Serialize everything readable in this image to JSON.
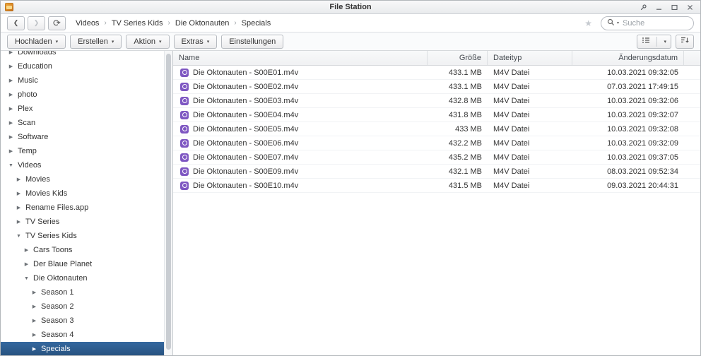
{
  "window": {
    "title": "File Station"
  },
  "icons": {
    "back": "❮",
    "forward": "❯",
    "refresh": "⟳",
    "star": "★",
    "caret": "▾",
    "search_caret": "▾",
    "expand": "▶",
    "collapse": "▼",
    "breadcrumb_sep": "›"
  },
  "nav": {
    "breadcrumb": [
      "Videos",
      "TV Series Kids",
      "Die Oktonauten",
      "Specials"
    ],
    "search_placeholder": "Suche"
  },
  "toolbar": {
    "buttons": [
      {
        "label": "Hochladen",
        "dropdown": true
      },
      {
        "label": "Erstellen",
        "dropdown": true
      },
      {
        "label": "Aktion",
        "dropdown": true
      },
      {
        "label": "Extras",
        "dropdown": true
      },
      {
        "label": "Einstellungen",
        "dropdown": false
      }
    ]
  },
  "sidebar": {
    "items": [
      {
        "label": "Downloads",
        "level": 0,
        "expanded": false,
        "selected": false
      },
      {
        "label": "Education",
        "level": 0,
        "expanded": false,
        "selected": false
      },
      {
        "label": "Music",
        "level": 0,
        "expanded": false,
        "selected": false
      },
      {
        "label": "photo",
        "level": 0,
        "expanded": false,
        "selected": false
      },
      {
        "label": "Plex",
        "level": 0,
        "expanded": false,
        "selected": false
      },
      {
        "label": "Scan",
        "level": 0,
        "expanded": false,
        "selected": false
      },
      {
        "label": "Software",
        "level": 0,
        "expanded": false,
        "selected": false
      },
      {
        "label": "Temp",
        "level": 0,
        "expanded": false,
        "selected": false
      },
      {
        "label": "Videos",
        "level": 0,
        "expanded": true,
        "selected": false
      },
      {
        "label": "Movies",
        "level": 1,
        "expanded": false,
        "selected": false
      },
      {
        "label": "Movies Kids",
        "level": 1,
        "expanded": false,
        "selected": false
      },
      {
        "label": "Rename Files.app",
        "level": 1,
        "expanded": false,
        "selected": false
      },
      {
        "label": "TV Series",
        "level": 1,
        "expanded": false,
        "selected": false
      },
      {
        "label": "TV Series Kids",
        "level": 1,
        "expanded": true,
        "selected": false
      },
      {
        "label": "Cars Toons",
        "level": 2,
        "expanded": false,
        "selected": false
      },
      {
        "label": "Der Blaue Planet",
        "level": 2,
        "expanded": false,
        "selected": false
      },
      {
        "label": "Die Oktonauten",
        "level": 2,
        "expanded": true,
        "selected": false
      },
      {
        "label": "Season 1",
        "level": 3,
        "expanded": false,
        "selected": false
      },
      {
        "label": "Season 2",
        "level": 3,
        "expanded": false,
        "selected": false
      },
      {
        "label": "Season 3",
        "level": 3,
        "expanded": false,
        "selected": false
      },
      {
        "label": "Season 4",
        "level": 3,
        "expanded": false,
        "selected": false
      },
      {
        "label": "Specials",
        "level": 3,
        "expanded": false,
        "selected": true
      }
    ]
  },
  "table": {
    "columns": [
      "Name",
      "Größe",
      "Dateityp",
      "Änderungsdatum"
    ],
    "rows": [
      {
        "name": "Die Oktonauten - S00E01.m4v",
        "size": "433.1 MB",
        "type": "M4V Datei",
        "date": "10.03.2021 09:32:05"
      },
      {
        "name": "Die Oktonauten - S00E02.m4v",
        "size": "433.1 MB",
        "type": "M4V Datei",
        "date": "07.03.2021 17:49:15"
      },
      {
        "name": "Die Oktonauten - S00E03.m4v",
        "size": "432.8 MB",
        "type": "M4V Datei",
        "date": "10.03.2021 09:32:06"
      },
      {
        "name": "Die Oktonauten - S00E04.m4v",
        "size": "431.8 MB",
        "type": "M4V Datei",
        "date": "10.03.2021 09:32:07"
      },
      {
        "name": "Die Oktonauten - S00E05.m4v",
        "size": "433 MB",
        "type": "M4V Datei",
        "date": "10.03.2021 09:32:08"
      },
      {
        "name": "Die Oktonauten - S00E06.m4v",
        "size": "432.2 MB",
        "type": "M4V Datei",
        "date": "10.03.2021 09:32:09"
      },
      {
        "name": "Die Oktonauten - S00E07.m4v",
        "size": "435.2 MB",
        "type": "M4V Datei",
        "date": "10.03.2021 09:37:05"
      },
      {
        "name": "Die Oktonauten - S00E09.m4v",
        "size": "432.1 MB",
        "type": "M4V Datei",
        "date": "08.03.2021 09:52:34"
      },
      {
        "name": "Die Oktonauten - S00E10.m4v",
        "size": "431.5 MB",
        "type": "M4V Datei",
        "date": "09.03.2021 20:44:31"
      }
    ]
  },
  "colors": {
    "sidebar_selection": "#2e5d92",
    "file_icon": "#7e57c2",
    "app_icon": "#e8962e"
  }
}
